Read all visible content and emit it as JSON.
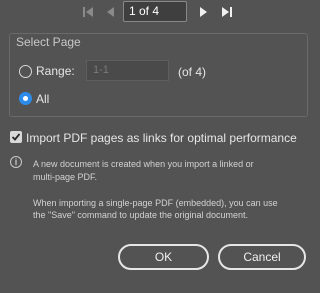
{
  "navigation": {
    "current_page": "1 of 4",
    "icons": [
      "first-page-icon",
      "previous-page-icon",
      "next-page-icon",
      "last-page-icon"
    ]
  },
  "select_page": {
    "title": "Select Page",
    "range_label": "Range:",
    "range_placeholder": "1-1",
    "range_suffix": "(of 4)",
    "all_label": "All",
    "selected": "All"
  },
  "import_option": {
    "label": "Import PDF pages as links for optimal performance",
    "checked": true
  },
  "info": {
    "line1": "A new document is created when you import a linked or",
    "line2": "multi-page PDF.",
    "line3": "When importing a single-page PDF (embedded), you can use",
    "line4": "the \"Save\" command to update the original document."
  },
  "buttons": {
    "ok": "OK",
    "cancel": "Cancel"
  },
  "colors": {
    "background": "#535353",
    "accent": "#2d8ceb"
  }
}
